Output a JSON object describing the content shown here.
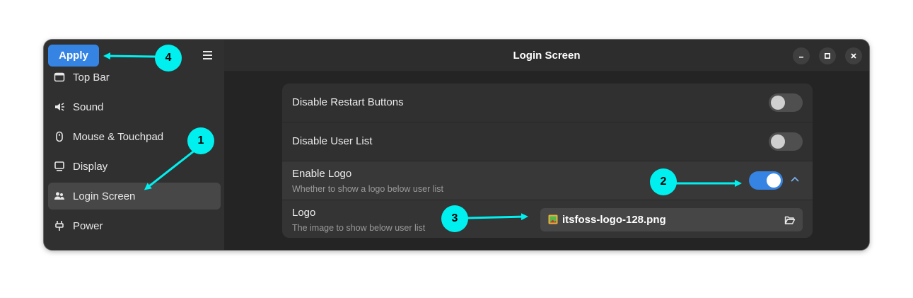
{
  "sidebar": {
    "apply_label": "Apply",
    "menu_icon": "hamburger-menu-icon",
    "items": [
      {
        "label": "Top Bar",
        "icon": "top-bar-icon",
        "active": false
      },
      {
        "label": "Sound",
        "icon": "speaker-icon",
        "active": false
      },
      {
        "label": "Mouse & Touchpad",
        "icon": "mouse-icon",
        "active": false
      },
      {
        "label": "Display",
        "icon": "monitor-icon",
        "active": false
      },
      {
        "label": "Login Screen",
        "icon": "users-icon",
        "active": true
      },
      {
        "label": "Power",
        "icon": "power-plug-icon",
        "active": false
      }
    ]
  },
  "header": {
    "title": "Login Screen",
    "buttons": [
      "minimize",
      "maximize",
      "close"
    ]
  },
  "settings": {
    "disable_restart": {
      "title": "Disable Restart Buttons",
      "enabled": false
    },
    "disable_user_list": {
      "title": "Disable User List",
      "enabled": false
    },
    "enable_logo": {
      "title": "Enable Logo",
      "subtitle": "Whether to show a logo below user list",
      "enabled": true,
      "expanded": true
    },
    "logo": {
      "title": "Logo",
      "subtitle": "The image to show below user list",
      "file": "itsfoss-logo-128.png"
    }
  },
  "annotations": [
    "1",
    "2",
    "3",
    "4"
  ],
  "colors": {
    "accent": "#3584e4",
    "annotation": "#00f0f0",
    "window_bg": "#242424",
    "sidebar_bg": "#303030"
  }
}
